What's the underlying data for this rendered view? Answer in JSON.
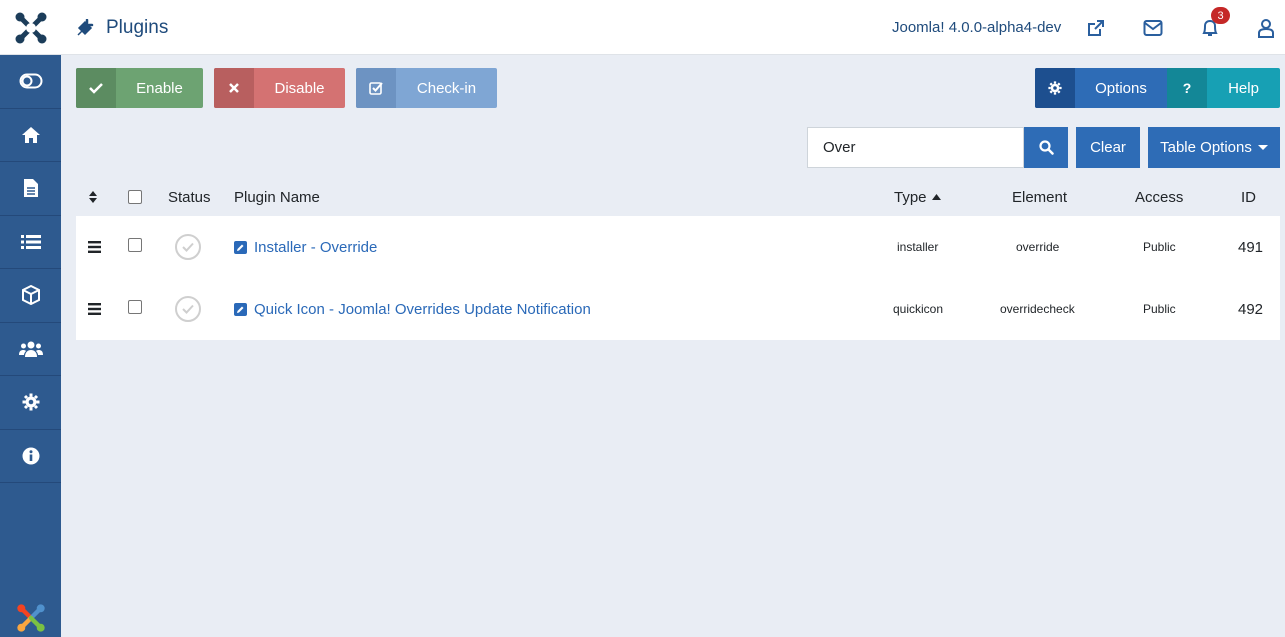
{
  "header": {
    "title": "Plugins",
    "version": "Joomla! 4.0.0-alpha4-dev",
    "notifications_count": "3"
  },
  "toolbar": {
    "enable_label": "Enable",
    "disable_label": "Disable",
    "checkin_label": "Check-in",
    "options_label": "Options",
    "help_label": "Help"
  },
  "search": {
    "value": "Over",
    "clear_label": "Clear",
    "table_options_label": "Table Options"
  },
  "table": {
    "headers": {
      "status": "Status",
      "name": "Plugin Name",
      "type": "Type",
      "element": "Element",
      "access": "Access",
      "id": "ID"
    },
    "rows": [
      {
        "name": "Installer - Override",
        "type": "installer",
        "element": "override",
        "access": "Public",
        "id": "491"
      },
      {
        "name": "Quick Icon - Joomla! Overrides Update Notification",
        "type": "quickicon",
        "element": "overridecheck",
        "access": "Public",
        "id": "492"
      }
    ]
  },
  "colors": {
    "sidebar": "#2e5a8f",
    "primary": "#2e6cb6",
    "success": "#6da372",
    "danger": "#d47272",
    "info": "#17a0b4"
  },
  "icons": {
    "sidebar": [
      "toggle-icon",
      "home-icon",
      "file-icon",
      "list-icon",
      "cube-icon",
      "users-icon",
      "gear-icon",
      "info-icon"
    ]
  }
}
